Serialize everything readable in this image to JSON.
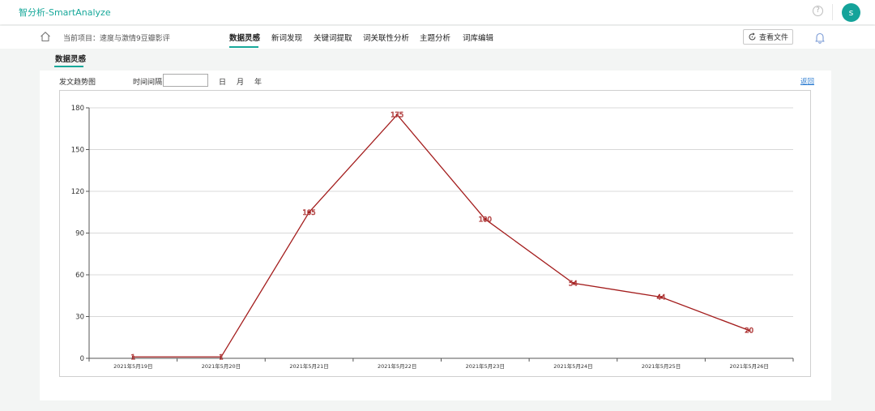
{
  "app": {
    "title": "智分析-SmartAnalyze",
    "help_icon": "question-circle-icon",
    "avatar_letter": "s",
    "accent_color": "#17a89a"
  },
  "nav": {
    "home_icon": "home-icon",
    "project_prefix": "当前项目：",
    "project_name": "速度与激情9豆瓣影评",
    "tabs": [
      {
        "label": "数据灵感",
        "active": true
      },
      {
        "label": "新词发现",
        "active": false
      },
      {
        "label": "关键词提取",
        "active": false
      },
      {
        "label": "词关联性分析",
        "active": false
      },
      {
        "label": "主题分析",
        "active": false
      },
      {
        "label": "词库编辑",
        "active": false
      }
    ],
    "view_file_label": "查看文件",
    "bell_icon": "bell-icon"
  },
  "section_tab": "数据灵感",
  "toolbar": {
    "chart_title": "发文趋势图",
    "interval_label": "时间间隔",
    "interval_value": "",
    "periods": [
      "日",
      "月",
      "年"
    ],
    "back_label": "返回"
  },
  "chart_data": {
    "type": "line",
    "categories": [
      "2021年5月19日",
      "2021年5月20日",
      "2021年5月21日",
      "2021年5月22日",
      "2021年5月23日",
      "2021年5月24日",
      "2021年5月25日",
      "2021年5月26日"
    ],
    "series": [
      {
        "values": [
          1,
          1,
          105,
          175,
          100,
          54,
          44,
          20
        ],
        "color": "#a31c1c"
      }
    ],
    "ylim": [
      0,
      180
    ],
    "yticks": [
      0,
      30,
      60,
      90,
      120,
      150,
      180
    ],
    "grid": true,
    "title": "",
    "xlabel": "",
    "ylabel": ""
  }
}
